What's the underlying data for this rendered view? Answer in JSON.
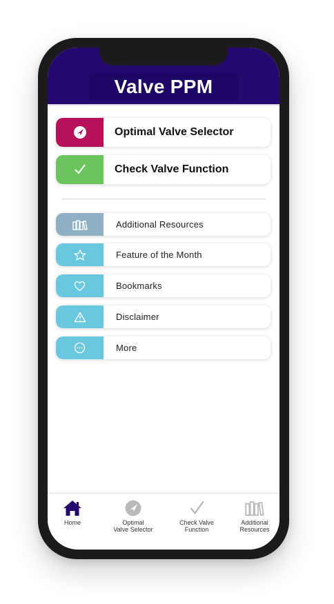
{
  "header": {
    "title": "Valve PPM"
  },
  "primary_buttons": [
    {
      "label": "Optimal Valve Selector",
      "icon": "compass-icon",
      "color": "#b6105b"
    },
    {
      "label": "Check Valve Function",
      "icon": "checkmark-icon",
      "color": "#6cc45d"
    }
  ],
  "menu_items": [
    {
      "label": "Additional Resources",
      "icon": "books-icon",
      "color": "#8db0c4"
    },
    {
      "label": "Feature of the Month",
      "icon": "star-icon",
      "color": "#69c8e0"
    },
    {
      "label": "Bookmarks",
      "icon": "heart-icon",
      "color": "#69c8e0"
    },
    {
      "label": "Disclaimer",
      "icon": "warning-icon",
      "color": "#69c8e0"
    },
    {
      "label": "More",
      "icon": "more-icon",
      "color": "#69c8e0"
    }
  ],
  "tabbar": {
    "home": {
      "label": "Home",
      "icon": "home-icon",
      "color": "#23096f"
    },
    "optimal": {
      "line1": "Optimal",
      "line2": "Valve Selector",
      "icon": "compass-icon",
      "color": "#b9b9b9"
    },
    "check": {
      "line1": "Check Valve",
      "line2": "Function",
      "icon": "checkmark-icon",
      "color": "#b9b9b9"
    },
    "resources": {
      "line1": "Additional",
      "line2": "Resources",
      "icon": "books-icon",
      "color": "#b9b9b9"
    }
  }
}
